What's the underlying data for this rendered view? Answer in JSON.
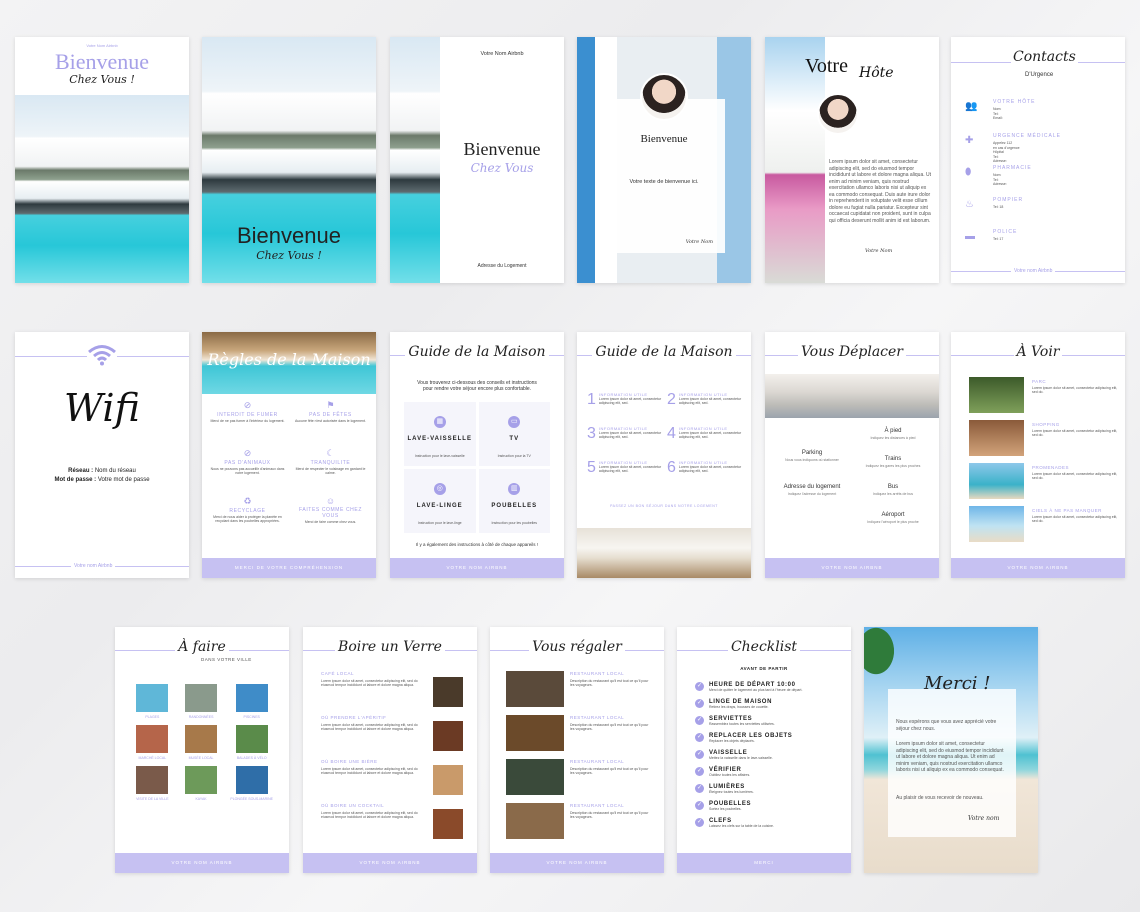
{
  "p1": {
    "host": "Votre Nom Airbnb",
    "title": "Bienvenue",
    "sub": "Chez Vous !"
  },
  "p2": {
    "title": "Bienvenue",
    "sub": "Chez Vous !"
  },
  "p3": {
    "host": "Votre Nom Airbnb",
    "title": "Bienvenue",
    "sub": "Chez Vous",
    "address": "Adresse du Logement"
  },
  "p4": {
    "title": "Bienvenue",
    "text": "Votre texte de bienvenue ici.",
    "sign": "Votre Nom"
  },
  "p5": {
    "title_a": "Votre",
    "title_b": "Hôte",
    "text": "Lorem ipsum dolor sit amet, consectetur adipiscing elit, sed do eiusmod tempor incididunt ut labore et dolore magna aliqua. Ut enim ad minim veniam, quis nostrud exercitation ullamco laboris nisi ut aliquip ex ea commodo consequat. Duis aute irure dolor in reprehenderit in voluptate velit esse cillum dolore eu fugiat nulla pariatur. Excepteur sint occaecat cupidatat non proident, sunt in culpa qui officia deserunt mollit anim id est laborum.",
    "sign": "Votre Nom"
  },
  "p6": {
    "title": "Contacts",
    "sub": "D'Urgence",
    "items": [
      {
        "label": "VOTRE HÔTE",
        "lines": "Nom:\nTel:\nEmail:",
        "icon": "people-icon"
      },
      {
        "label": "URGENCE MÉDICALE",
        "lines": "Appelez 112\nen cas d'urgence\nHôpital\nTel:\nAdresse:",
        "icon": "cross-icon"
      },
      {
        "label": "PHARMACIE",
        "lines": "Nom:\nTel:\nAdresse:",
        "icon": "pill-icon"
      },
      {
        "label": "POMPIER",
        "lines": "Tel: 18",
        "icon": "flame-icon"
      },
      {
        "label": "POLICE",
        "lines": "Tel: 17",
        "icon": "car-icon"
      }
    ],
    "footer": "Votre nom Airbnb"
  },
  "p7": {
    "title": "Wifi",
    "network_label": "Réseau :",
    "network": "Nom du réseau",
    "pass_label": "Mot de passe :",
    "pass": "Votre mot de passe",
    "footer": "Votre nom Airbnb"
  },
  "p8": {
    "title": "Règles de la Maison",
    "rules": [
      {
        "label": "INTERDIT DE FUMER",
        "text": "Merci de ne pas fumer à l'intérieur du logement."
      },
      {
        "label": "PAS DE FÊTES",
        "text": "Aucune fête n'est autorisée dans le logement."
      },
      {
        "label": "PAS D'ANIMAUX",
        "text": "Nous ne pouvons pas accueillir d'animaux dans notre logement."
      },
      {
        "label": "TRANQUILITE",
        "text": "Merci de respecter le voisinage en gardant le calme."
      },
      {
        "label": "RECYCLAGE",
        "text": "Merci de nous aider à protéger la planète en recyclant dans les poubelles appropriées."
      },
      {
        "label": "FAITES COMME CHEZ VOUS",
        "text": "Merci de faire comme chez vous."
      }
    ],
    "footer": "MERCI DE VOTRE COMPRÉHENSION"
  },
  "p9": {
    "title": "Guide de la Maison",
    "intro": "Vous trouverez ci-dessous des conseils et instructions pour rendre votre séjour encore plus confortable.",
    "items": [
      {
        "label": "LAVE-VAISSELLE",
        "text": "Instruction pour le lave-vaisselle"
      },
      {
        "label": "TV",
        "text": "Instruction pour la TV"
      },
      {
        "label": "LAVE-LINGE",
        "text": "Instruction pour le lave-linge"
      },
      {
        "label": "POUBELLES",
        "text": "Instruction pour les poubelles"
      }
    ],
    "note": "Il y a également des instructions à côté de chaque appareils !",
    "footer": "VOTRE NOM AIRBNB"
  },
  "p10": {
    "title": "Guide de la Maison",
    "items": [
      {
        "n": "1",
        "label": "INFORMATION UTILE"
      },
      {
        "n": "2",
        "label": "INFORMATION UTILE"
      },
      {
        "n": "3",
        "label": "INFORMATION UTILE"
      },
      {
        "n": "4",
        "label": "INFORMATION UTILE"
      },
      {
        "n": "5",
        "label": "INFORMATION UTILE"
      },
      {
        "n": "6",
        "label": "INFORMATION UTILE"
      }
    ],
    "item_text": "Lorem ipsum dolor sit amet, consectetur adipiscing elit, sed.",
    "note": "PASSEZ UN BON SÉJOUR DANS NOTRE LOGEMENT"
  },
  "p11": {
    "title": "Vous Déplacer",
    "left": [
      {
        "label": "Parking",
        "text": "Nous vous indiquons où stationner"
      },
      {
        "label": "Adresse du logement",
        "text": "Indiquez l'adresse du logement"
      }
    ],
    "right": [
      {
        "label": "À pied",
        "text": "Indiquez les distances à pied"
      },
      {
        "label": "Trains",
        "text": "Indiquez les gares les plus proches"
      },
      {
        "label": "Bus",
        "text": "Indiquez les arrêts de bus"
      },
      {
        "label": "Aéroport",
        "text": "Indiquez l'aéroport le plus proche"
      }
    ],
    "footer": "VOTRE NOM AIRBNB"
  },
  "p12": {
    "title": "À Voir",
    "items": [
      {
        "label": "PARC"
      },
      {
        "label": "SHOPPING"
      },
      {
        "label": "PROMENADES"
      },
      {
        "label": "CIELS À NE PAS MANQUER"
      }
    ],
    "item_text": "Lorem ipsum dolor sit amet, consectetur adipiscing elit, sed do.",
    "footer": "VOTRE NOM AIRBNB"
  },
  "p13": {
    "title": "À faire",
    "sub": "DANS VOTRE VILLE",
    "items": [
      "PLAGES",
      "RANDONNÉES",
      "PISCINES",
      "MARCHÉ LOCAL",
      "MUSÉE LOCAL",
      "BALADES À VÉLO",
      "VISITE DE LA VILLE",
      "KAYAK",
      "PLONGÉE SOUS-MARINE"
    ],
    "footer": "VOTRE NOM AIRBNB"
  },
  "p14": {
    "title": "Boire un Verre",
    "items": [
      "CAFÉ LOCAL",
      "OÙ PRENDRE L'APÉRITIF",
      "OÙ BOIRE UNE BIÈRE",
      "OÙ BOIRE UN COCKTAIL"
    ],
    "item_text": "Lorem ipsum dolor sit amet, consectetur adipiscing elit, sed do eiusmod tempor incididunt ut labore et dolore magna aliqua.",
    "footer": "VOTRE NOM AIRBNB"
  },
  "p15": {
    "title": "Vous régaler",
    "items": [
      "RESTAURANT LOCAL",
      "RESTAURANT LOCAL",
      "RESTAURANT LOCAL",
      "RESTAURANT LOCAL"
    ],
    "item_text": "Description du restaurant qu'il est tout ce qu'il pour les voyageurs.",
    "footer": "VOTRE NOM AIRBNB"
  },
  "p16": {
    "title": "Checklist",
    "sub": "AVANT DE PARTIR",
    "items": [
      {
        "label": "HEURE DE DÉPART 10:00",
        "text": "Merci de quitter le logement au plus tard à l'heure de départ."
      },
      {
        "label": "LINGE DE MAISON",
        "text": "Retirez les draps, housses de couette."
      },
      {
        "label": "SERVIETTES",
        "text": "Rassemblez toutes les serviettes utilisées."
      },
      {
        "label": "REPLACER LES OBJETS",
        "text": "Replacer les objets déplacés."
      },
      {
        "label": "VAISSELLE",
        "text": "Mettez la vaisselle dans le lave-vaisselle."
      },
      {
        "label": "VÉRIFIER",
        "text": "Oubliez toutes les affaires."
      },
      {
        "label": "LUMIÈRES",
        "text": "Éteignez toutes les lumières."
      },
      {
        "label": "POUBELLES",
        "text": "Sortez les poubelles."
      },
      {
        "label": "CLEFS",
        "text": "Laissez les clefs sur la table de la cuisine."
      }
    ],
    "footer": "MERCI"
  },
  "p17": {
    "title": "Merci !",
    "text1": "Nous espérons que vous avez apprécié votre séjour chez nous.",
    "text2": "Lorem ipsum dolor sit amet, consectetur adipiscing elit, sed do eiusmod tempor incididunt ut labore et dolore magna aliqua. Ut enim ad minim veniam, quis nostrud exercitation ullamco laboris nisi ut aliquip ex ea commodo consequat.",
    "text3": "Au plaisir de vous recevoir de nouveau.",
    "sign": "Votre nom"
  },
  "colors": {
    "accent": "#a6a0e8",
    "footer_bar": "#c6c1f2",
    "background": "#eeeeef"
  }
}
